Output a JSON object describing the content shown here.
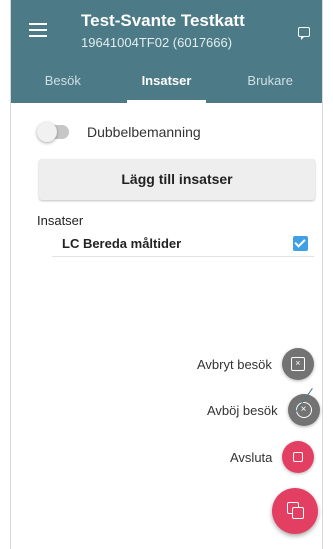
{
  "header": {
    "title": "Test-Svante Testkatt",
    "subtitle": "19641004TF02 (6017666)"
  },
  "tabs": [
    {
      "label": "Besök",
      "active": false
    },
    {
      "label": "Insatser",
      "active": true
    },
    {
      "label": "Brukare",
      "active": false
    }
  ],
  "toggle": {
    "label": "Dubbelbemanning",
    "on": false
  },
  "add_button": {
    "label": "Lägg till insatser"
  },
  "insatser": {
    "title": "Insatser",
    "items": [
      {
        "label": "LC Bereda måltider",
        "checked": true
      }
    ]
  },
  "fab_menu": {
    "items": [
      {
        "label": "Avbryt besök",
        "icon": "calendar-x-icon",
        "color": "#737373"
      },
      {
        "label": "Avböj besök",
        "icon": "circle-x-icon",
        "color": "#737373"
      },
      {
        "label": "Avsluta",
        "icon": "stop-icon",
        "color": "#e23f63"
      }
    ],
    "main_icon": "copy-icon",
    "main_color": "#e23f63"
  },
  "colors": {
    "appbar": "#4c7a86",
    "accent": "#e23f63",
    "checkbox": "#3fa0e6"
  }
}
